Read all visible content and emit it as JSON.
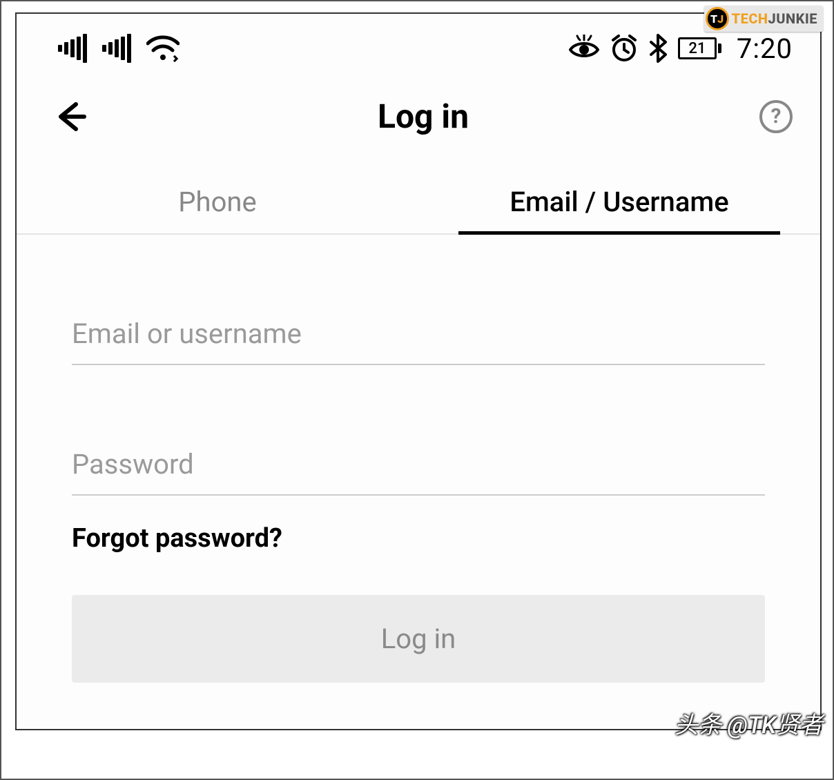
{
  "status_bar": {
    "battery_level": "21",
    "clock": "7:20"
  },
  "header": {
    "title": "Log in"
  },
  "tabs": {
    "phone": "Phone",
    "email": "Email / Username"
  },
  "form": {
    "email_placeholder": "Email or username",
    "password_placeholder": "Password",
    "forgot_label": "Forgot password?",
    "submit_label": "Log in"
  },
  "overlay": {
    "brand_tech": "TECH",
    "brand_junkie": "JUNKIE",
    "watermark": "头条 @TK贤者"
  }
}
